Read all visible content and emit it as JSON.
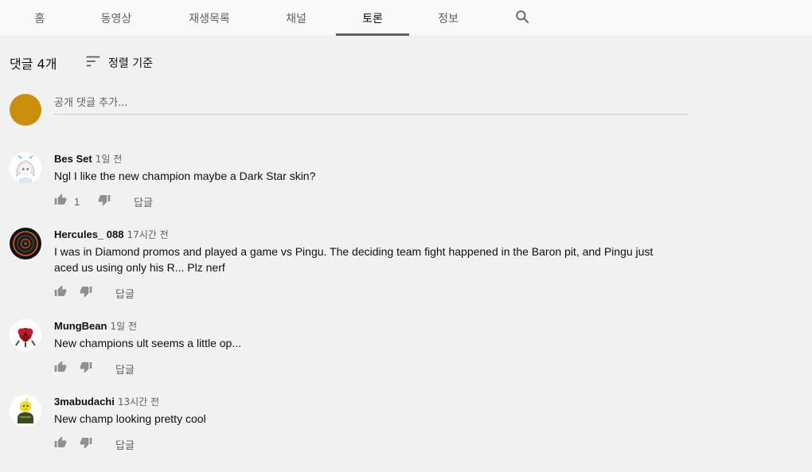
{
  "tabs": [
    {
      "label": "홈",
      "active": false
    },
    {
      "label": "동영상",
      "active": false
    },
    {
      "label": "재생목록",
      "active": false
    },
    {
      "label": "채널",
      "active": false
    },
    {
      "label": "토론",
      "active": true
    },
    {
      "label": "정보",
      "active": false
    }
  ],
  "search_icon": "search-icon",
  "header": {
    "count_label": "댓글 4개",
    "sort_label": "정렬 기준",
    "sort_icon": "sort-icon"
  },
  "add_comment": {
    "placeholder": "공개 댓글 추가...",
    "avatar_color": "#c98e0b"
  },
  "colors": {
    "background": "#f1f1f1",
    "tabbar": "#f9f9f9",
    "secondary_text": "#606060",
    "icon": "#909090"
  },
  "comments": [
    {
      "author": "Bes Set",
      "time": "1일 전",
      "text": "Ngl I like the new champion maybe a Dark Star skin?",
      "likes": "1",
      "reply_label": "답글",
      "avatar": "anime-girl-avatar"
    },
    {
      "author": "Hercules_ 088",
      "time": "17시간 전",
      "text": "I was in Diamond promos and played a game vs Pingu. The deciding team fight happened in the Baron pit, and Pingu just aced us using only his R... Plz nerf",
      "likes": "",
      "reply_label": "답글",
      "avatar": "dark-ring-avatar"
    },
    {
      "author": "MungBean",
      "time": "1일 전",
      "text": "New champions ult seems a little op...",
      "likes": "",
      "reply_label": "답글",
      "avatar": "red-rose-avatar"
    },
    {
      "author": "3mabudachi",
      "time": "13시간 전",
      "text": "New champ looking pretty cool",
      "likes": "",
      "reply_label": "답글",
      "avatar": "chick-avatar"
    }
  ]
}
